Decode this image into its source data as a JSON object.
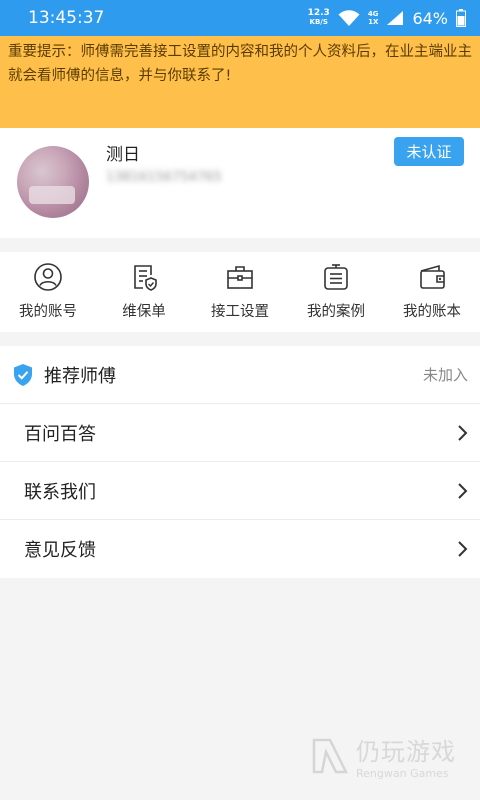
{
  "status_bar": {
    "time": "13:45:37",
    "net_speed_value": "12.3",
    "net_speed_unit": "KB/S",
    "signal_4g": "4G",
    "signal_1x": "1X",
    "battery": "64%"
  },
  "notice": {
    "text": "重要提示：师傅需完善接工设置的内容和我的个人资料后，在业主端业主就会看师傅的信息，并与你联系了!"
  },
  "profile": {
    "name": "测日",
    "phone": "13816156754765",
    "verify_label": "未认证"
  },
  "grid": {
    "items": [
      {
        "label": "我的账号",
        "icon": "user-icon"
      },
      {
        "label": "维保单",
        "icon": "document-shield-icon"
      },
      {
        "label": "接工设置",
        "icon": "toolbox-icon"
      },
      {
        "label": "我的案例",
        "icon": "case-list-icon"
      },
      {
        "label": "我的账本",
        "icon": "wallet-icon"
      }
    ]
  },
  "list": {
    "recommend_label": "推荐师傅",
    "recommend_status": "未加入",
    "items": [
      {
        "label": "百问百答"
      },
      {
        "label": "联系我们"
      },
      {
        "label": "意见反馈"
      }
    ]
  },
  "watermark": {
    "cn": "仍玩游戏",
    "en": "Rengwan Games"
  },
  "colors": {
    "primary": "#2f9bef",
    "notice_bg": "#ffc04b",
    "verify_bg": "#3aa3ef"
  }
}
